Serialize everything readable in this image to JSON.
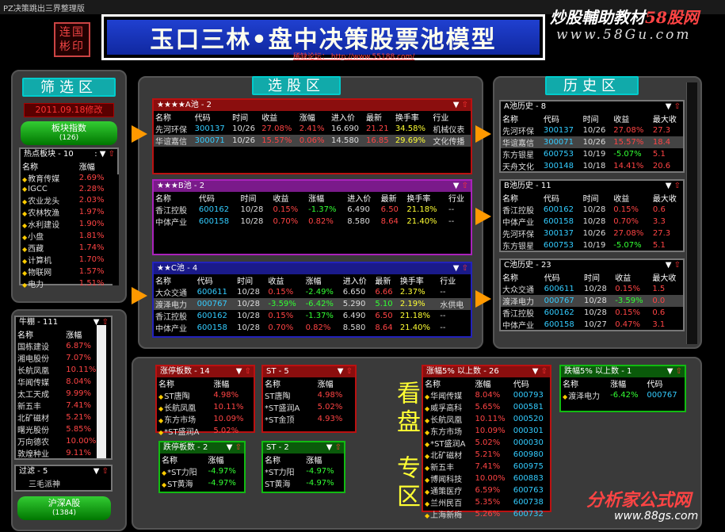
{
  "window_title": "PZ决策跳出三界整理版",
  "logo_text": "连国彬印",
  "banner_title": "玉口三林•盘中决策股票池模型",
  "forum_link": "稀缺论坛：   http://www.55188.com/",
  "brand": {
    "name": "炒股輔助教材",
    "num": "58股网",
    "url": "www.58Gu.com"
  },
  "watermark": {
    "name": "分析家公式网",
    "url": "www.88gs.com"
  },
  "sections": {
    "filter": "筛选区",
    "select": "选股区",
    "history": "历史区",
    "watch_a": "看盘",
    "watch_b": "专区"
  },
  "filter_date": "2011.09.18修改",
  "sector_button": {
    "label": "板块指数",
    "count": "(126)"
  },
  "hot_sector": {
    "title": "热点板块 - 10",
    "cols": [
      "名称",
      "涨幅"
    ],
    "rows": [
      [
        "教育传媒",
        "2.69%"
      ],
      [
        "IGCC",
        "2.28%"
      ],
      [
        "农业龙头",
        "2.03%"
      ],
      [
        "农林牧渔",
        "1.97%"
      ],
      [
        "水利建设",
        "1.90%"
      ],
      [
        "小盘",
        "1.81%"
      ],
      [
        "西藏",
        "1.74%"
      ],
      [
        "计算机",
        "1.70%"
      ],
      [
        "物联网",
        "1.57%"
      ],
      [
        "电力",
        "1.51%"
      ]
    ]
  },
  "bull_market": {
    "title": "牛棚 - 111",
    "cols": [
      "名称",
      "涨幅"
    ],
    "rows": [
      [
        "国栋建设",
        "6.87%"
      ],
      [
        "湘电股份",
        "7.07%"
      ],
      [
        "长航凤凰",
        "10.11%"
      ],
      [
        "华闻传媒",
        "8.04%"
      ],
      [
        "太工天成",
        "9.99%"
      ],
      [
        "新五丰",
        "7.41%"
      ],
      [
        "北矿磁材",
        "5.21%"
      ],
      [
        "曙光股份",
        "5.85%"
      ],
      [
        "万向德农",
        "10.00%"
      ],
      [
        "敦煌种业",
        "9.11%"
      ]
    ]
  },
  "filter_box": {
    "title": "过滤 - 5",
    "item": "三毛派神"
  },
  "market_button": {
    "label": "沪深A股",
    "count": "(1384)"
  },
  "pool_a": {
    "title": "★★★★A池 - 2",
    "cols": [
      "名称",
      "代码",
      "时间",
      "收益",
      "涨幅",
      "进入价",
      "最新",
      "换手率",
      "行业"
    ],
    "rows": [
      [
        "先河环保",
        "300137",
        "10/26",
        "27.08%",
        "2.41%",
        "16.690",
        "21.21",
        "34.58%",
        "机械仪表"
      ],
      [
        "华谊嘉信",
        "300071",
        "10/26",
        "15.57%",
        "0.06%",
        "14.580",
        "16.85",
        "29.69%",
        "文化传播"
      ]
    ]
  },
  "pool_b": {
    "title": "★★★B池 - 2",
    "cols": [
      "名称",
      "代码",
      "时间",
      "收益",
      "涨幅",
      "进入价",
      "最新",
      "换手率",
      "行业"
    ],
    "rows": [
      [
        "香江控股",
        "600162",
        "10/28",
        "0.15%",
        "-1.37%",
        "6.490",
        "6.50",
        "21.18%",
        "--"
      ],
      [
        "中体产业",
        "600158",
        "10/28",
        "0.70%",
        "0.82%",
        "8.580",
        "8.64",
        "21.40%",
        "--"
      ]
    ]
  },
  "pool_c": {
    "title": "★★C池 - 4",
    "cols": [
      "名称",
      "代码",
      "时间",
      "收益",
      "涨幅",
      "进入价",
      "最新",
      "换手率",
      "行业"
    ],
    "rows": [
      [
        "大众交通",
        "600611",
        "10/28",
        "0.15%",
        "-2.49%",
        "6.650",
        "6.66",
        "2.37%",
        "--"
      ],
      [
        "渡泽电力",
        "000767",
        "10/28",
        "-3.59%",
        "-6.42%",
        "5.290",
        "5.10",
        "2.19%",
        "水供电"
      ],
      [
        "香江控股",
        "600162",
        "10/28",
        "0.15%",
        "-1.37%",
        "6.490",
        "6.50",
        "21.18%",
        "--"
      ],
      [
        "中体产业",
        "600158",
        "10/28",
        "0.70%",
        "0.82%",
        "8.580",
        "8.64",
        "21.40%",
        "--"
      ]
    ]
  },
  "hist_a": {
    "title": "A池历史 - 8",
    "cols": [
      "名称",
      "代码",
      "时间",
      "收益",
      "最大收"
    ],
    "rows": [
      [
        "先河环保",
        "300137",
        "10/26",
        "27.08%",
        "27.3"
      ],
      [
        "华谊嘉信",
        "300071",
        "10/26",
        "15.57%",
        "18.4"
      ],
      [
        "东方银星",
        "600753",
        "10/19",
        "-5.07%",
        "5.1"
      ],
      [
        "天舟文化",
        "300148",
        "10/18",
        "14.41%",
        "20.6"
      ]
    ]
  },
  "hist_b": {
    "title": "B池历史 - 11",
    "cols": [
      "名称",
      "代码",
      "时间",
      "收益",
      "最大收"
    ],
    "rows": [
      [
        "香江控股",
        "600162",
        "10/28",
        "0.15%",
        "0.6"
      ],
      [
        "中体产业",
        "600158",
        "10/28",
        "0.70%",
        "3.3"
      ],
      [
        "先河环保",
        "300137",
        "10/26",
        "27.08%",
        "27.3"
      ],
      [
        "东方银星",
        "600753",
        "10/19",
        "-5.07%",
        "5.1"
      ]
    ]
  },
  "hist_c": {
    "title": "C池历史 - 23",
    "cols": [
      "名称",
      "代码",
      "时间",
      "收益",
      "最大收"
    ],
    "rows": [
      [
        "大众交通",
        "600611",
        "10/28",
        "0.15%",
        "1.5"
      ],
      [
        "渡泽电力",
        "000767",
        "10/28",
        "-3.59%",
        "0.0"
      ],
      [
        "香江控股",
        "600162",
        "10/28",
        "0.15%",
        "0.6"
      ],
      [
        "中体产业",
        "600158",
        "10/27",
        "0.47%",
        "3.1"
      ]
    ]
  },
  "limit_up": {
    "title": "涨停板数 - 14",
    "cols": [
      "名称",
      "涨幅"
    ],
    "rows": [
      [
        "ST唐陶",
        "4.98%"
      ],
      [
        "长航凤凰",
        "10.11%"
      ],
      [
        "东方市场",
        "10.09%"
      ],
      [
        "*ST盛润A",
        "5.02%"
      ]
    ]
  },
  "st_up": {
    "title": "ST - 5",
    "cols": [
      "名称",
      "涨幅"
    ],
    "rows": [
      [
        "ST唐陶",
        "4.98%"
      ],
      [
        "*ST盛润A",
        "5.02%"
      ],
      [
        "*ST金顶",
        "4.93%"
      ]
    ]
  },
  "limit_down": {
    "title": "跌停板数 - 2",
    "cols": [
      "名称",
      "涨幅"
    ],
    "rows": [
      [
        "*ST力阳",
        "-4.97%"
      ],
      [
        "ST黄海",
        "-4.97%"
      ]
    ]
  },
  "st_down": {
    "title": "ST - 2",
    "cols": [
      "名称",
      "涨幅"
    ],
    "rows": [
      [
        "*ST力阳",
        "-4.97%"
      ],
      [
        "ST黄海",
        "-4.97%"
      ]
    ]
  },
  "rise5": {
    "title": "涨幅5% 以上数 - 26",
    "cols": [
      "名称",
      "涨幅",
      "代码"
    ],
    "rows": [
      [
        "华闻传媒",
        "8.04%",
        "000793"
      ],
      [
        "威孚高科",
        "5.65%",
        "000581"
      ],
      [
        "长航凤凰",
        "10.11%",
        "000520"
      ],
      [
        "东方市场",
        "10.09%",
        "000301"
      ],
      [
        "*ST盛润A",
        "5.02%",
        "000030"
      ],
      [
        "北矿磁材",
        "5.21%",
        "600980"
      ],
      [
        "新五丰",
        "7.41%",
        "600975"
      ],
      [
        "博闻科技",
        "10.00%",
        "600883"
      ],
      [
        "通策医疗",
        "6.59%",
        "600763"
      ],
      [
        "兰州民百",
        "5.35%",
        "600738"
      ],
      [
        "上海新梅",
        "5.26%",
        "600732"
      ]
    ]
  },
  "fall5": {
    "title": "跌幅5% 以上数 - 1",
    "cols": [
      "名称",
      "涨幅",
      "代码"
    ],
    "rows": [
      [
        "渡泽电力",
        "-6.42%",
        "000767"
      ]
    ]
  }
}
